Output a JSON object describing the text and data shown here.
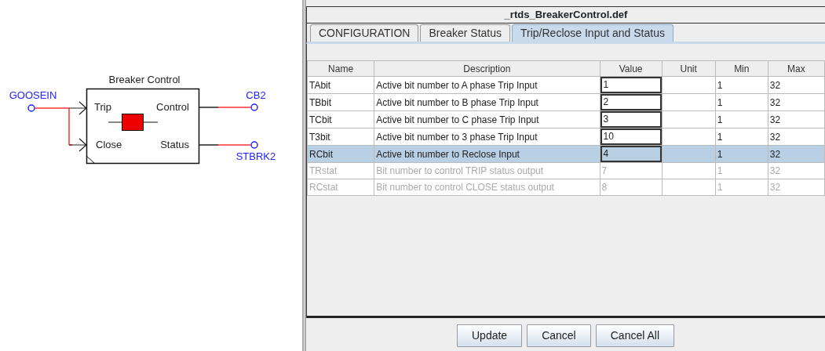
{
  "diagram": {
    "title": "Breaker Control",
    "ports": [
      {
        "label": "Trip",
        "kind": "input"
      },
      {
        "label": "Close",
        "kind": "input"
      },
      {
        "label": "Control",
        "kind": "output"
      },
      {
        "label": "Status",
        "kind": "output"
      }
    ],
    "signals": [
      {
        "label": "GOOSEIN"
      },
      {
        "label": "CB2"
      },
      {
        "label": "STBRK2"
      }
    ]
  },
  "dialog": {
    "title": "_rtds_BreakerControl.def",
    "tabs": [
      {
        "label": "CONFIGURATION",
        "selected": false
      },
      {
        "label": "Breaker Status",
        "selected": false
      },
      {
        "label": "Trip/Reclose Input and Status",
        "selected": true
      }
    ],
    "table": {
      "columns": [
        "Name",
        "Description",
        "Value",
        "Unit",
        "Min",
        "Max"
      ],
      "rows": [
        {
          "name": "TAbit",
          "description": "Active bit number to A phase Trip Input",
          "value": "1",
          "min": "1",
          "max": "32",
          "disabled": false,
          "selected": false
        },
        {
          "name": "TBbit",
          "description": "Active bit number to B phase Trip Input",
          "value": "2",
          "min": "1",
          "max": "32",
          "disabled": false,
          "selected": false
        },
        {
          "name": "TCbit",
          "description": "Active bit number to C phase Trip Input",
          "value": "3",
          "min": "1",
          "max": "32",
          "disabled": false,
          "selected": false
        },
        {
          "name": "T3bit",
          "description": "Active bit number to 3 phase Trip Input",
          "value": "10",
          "min": "1",
          "max": "32",
          "disabled": false,
          "selected": false
        },
        {
          "name": "RCbit",
          "description": "Active bit number to Reclose Input",
          "value": "4",
          "min": "1",
          "max": "32",
          "disabled": false,
          "selected": true
        },
        {
          "name": "TRstat",
          "description": "Bit number to control TRIP status output",
          "value": "7",
          "min": "1",
          "max": "32",
          "disabled": true,
          "selected": false
        },
        {
          "name": "RCstat",
          "description": "Bit number to control CLOSE status output",
          "value": "8",
          "min": "1",
          "max": "32",
          "disabled": true,
          "selected": false
        }
      ]
    },
    "buttons": [
      "Update",
      "Cancel",
      "Cancel All"
    ]
  }
}
